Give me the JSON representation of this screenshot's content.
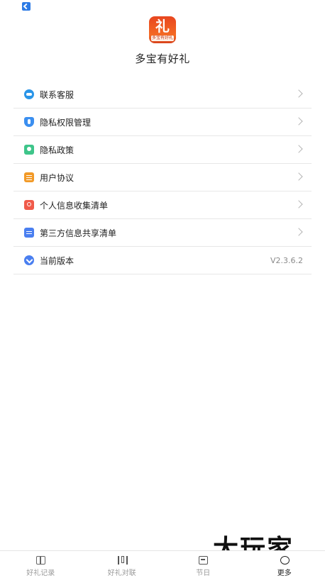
{
  "app": {
    "name": "多宝有好礼",
    "logo_glyph": "礼",
    "logo_band_text": "多宝有好礼"
  },
  "menu": {
    "items": [
      {
        "label": "联系客服",
        "icon": "headset-icon",
        "color": "#2a95e8"
      },
      {
        "label": "隐私权限管理",
        "icon": "shield-icon",
        "color": "#3b8ff0"
      },
      {
        "label": "隐私政策",
        "icon": "bookmark-icon",
        "color": "#3ec58a"
      },
      {
        "label": "用户协议",
        "icon": "document-icon",
        "color": "#f29a28"
      },
      {
        "label": "个人信息收集清单",
        "icon": "person-card-icon",
        "color": "#f05a4a"
      },
      {
        "label": "第三方信息共享清单",
        "icon": "document-icon",
        "color": "#4a7ff0"
      }
    ],
    "version": {
      "label": "当前版本",
      "value": "V2.3.6.2",
      "icon": "version-icon"
    }
  },
  "watermark": "大玩家",
  "tabs": [
    {
      "label": "好礼记录",
      "icon": "gift-icon",
      "active": false
    },
    {
      "label": "好礼对联",
      "icon": "couplet-icon",
      "active": false
    },
    {
      "label": "节日",
      "icon": "calendar-icon",
      "active": false
    },
    {
      "label": "更多",
      "icon": "more-icon",
      "active": true
    }
  ]
}
